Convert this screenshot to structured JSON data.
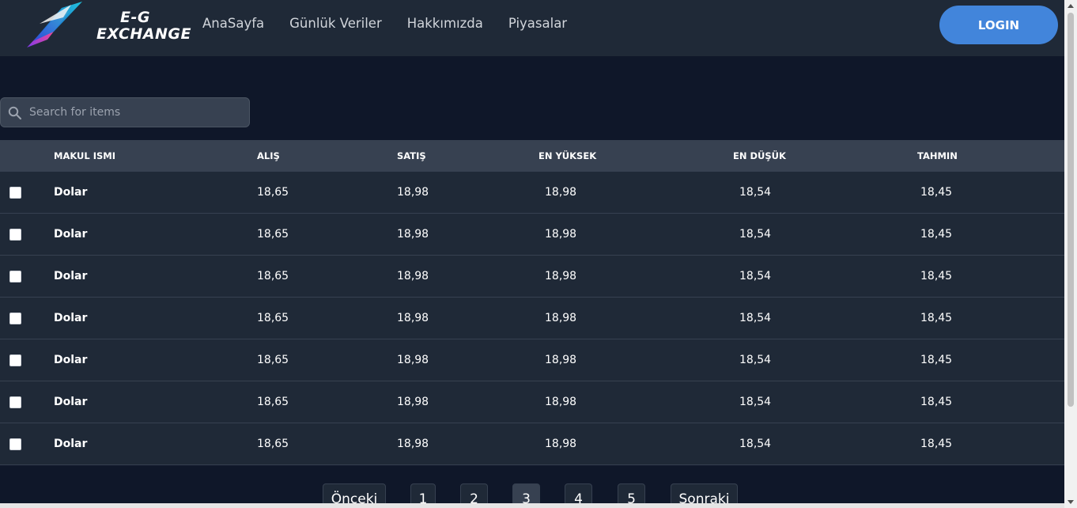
{
  "brand": {
    "logo_line1": "E-G",
    "logo_line2": "EXCHANGE"
  },
  "nav": {
    "links": [
      "AnaSayfa",
      "Günlük Veriler",
      "Hakkımızda",
      "Piyasalar"
    ],
    "login_label": "LOGIN"
  },
  "search": {
    "placeholder": "Search for items",
    "value": ""
  },
  "table": {
    "headers": [
      "MAKUL ISMI",
      "ALIŞ",
      "SATIŞ",
      "EN YÜKSEK",
      "EN DÜŞÜK",
      "TAHMIN"
    ],
    "rows": [
      [
        "Dolar",
        "18,65",
        "18,98",
        "18,98",
        "18,54",
        "18,45"
      ],
      [
        "Dolar",
        "18,65",
        "18,98",
        "18,98",
        "18,54",
        "18,45"
      ],
      [
        "Dolar",
        "18,65",
        "18,98",
        "18,98",
        "18,54",
        "18,45"
      ],
      [
        "Dolar",
        "18,65",
        "18,98",
        "18,98",
        "18,54",
        "18,45"
      ],
      [
        "Dolar",
        "18,65",
        "18,98",
        "18,98",
        "18,54",
        "18,45"
      ],
      [
        "Dolar",
        "18,65",
        "18,98",
        "18,98",
        "18,54",
        "18,45"
      ],
      [
        "Dolar",
        "18,65",
        "18,98",
        "18,98",
        "18,54",
        "18,45"
      ]
    ]
  },
  "pagination": {
    "prev_label": "Önceki",
    "pages": [
      "1",
      "2",
      "3",
      "4",
      "5"
    ],
    "active_page": "3",
    "next_label": "Sonraki"
  },
  "colors": {
    "page_bg": "#0f1729",
    "nav_bg": "#1f2937",
    "accent": "#4285db",
    "header_bg": "#374151"
  }
}
